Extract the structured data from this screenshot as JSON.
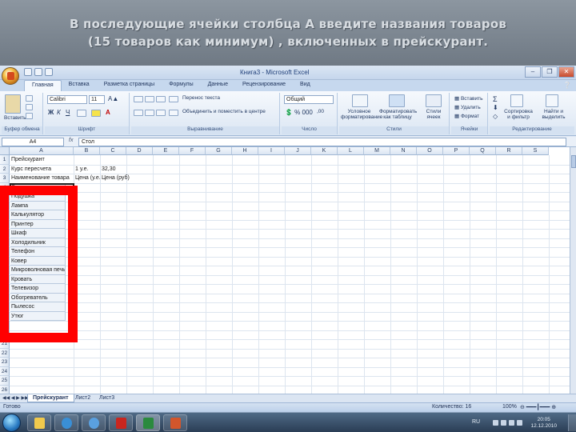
{
  "slide": {
    "title_line1": "В последующие ячейки столбца А введите названия товаров",
    "title_line2": "(15 товаров как минимум) , включенных в прейскурант."
  },
  "window": {
    "title": "Книга3 - Microsoft Excel",
    "controls": [
      "–",
      "❐",
      "✕"
    ]
  },
  "tabs": [
    "Главная",
    "Вставка",
    "Разметка страницы",
    "Формулы",
    "Данные",
    "Рецензирование",
    "Вид"
  ],
  "ribbon": {
    "groups": [
      "Буфер обмена",
      "Шрифт",
      "Выравнивание",
      "Число",
      "Стили",
      "Ячейки",
      "Редактирование"
    ],
    "paste_label": "Вставить",
    "font_name": "Calibri",
    "font_size": "11",
    "wrap_text": "Перенос текста",
    "merge_center": "Объединить и поместить в центре",
    "number_format": "Общий",
    "cond_format": "Условное форматирование",
    "format_table": "Форматировать как таблицу",
    "cell_styles": "Стили ячеек",
    "insert": "Вставить",
    "delete": "Удалить",
    "format": "Формат",
    "sort_filter": "Сортировка и фильтр",
    "find_select": "Найти и выделить"
  },
  "formula_bar": {
    "name_box": "A4",
    "fx": "fx",
    "content": "Стол"
  },
  "grid": {
    "columns": [
      "A",
      "B",
      "C",
      "D",
      "E",
      "F",
      "G",
      "H",
      "I",
      "J",
      "K",
      "L",
      "M",
      "N",
      "O",
      "P",
      "Q",
      "R",
      "S"
    ],
    "rows": [
      "1",
      "2",
      "3",
      "4",
      "5",
      "6",
      "7",
      "8",
      "9",
      "10",
      "11",
      "12",
      "13",
      "14",
      "15",
      "16",
      "17",
      "18",
      "19",
      "20",
      "21",
      "22",
      "23",
      "24",
      "25",
      "26"
    ],
    "r1_a": "Прейскурант",
    "r2_a": "Курс пересчета",
    "r2_b": "1 у.е.",
    "r2_c": "32,30",
    "r3_a": "Наименование товара",
    "r3_b": "Цена (у.е.)",
    "r3_c": "Цена (руб)",
    "items": [
      "Стол",
      "Подушка",
      "Лампа",
      "Калькулятор",
      "Принтер",
      "Шкаф",
      "Холодильник",
      "Телефон",
      "Ковер",
      "Микроволновая печь",
      "Кровать",
      "Телевизор",
      "Обогреватель",
      "Пылесос",
      "Утюг"
    ]
  },
  "sheets": [
    "Прейскурант",
    "Лист2",
    "Лист3"
  ],
  "status": {
    "ready": "Готово",
    "count": "Количество: 16",
    "zoom": "100%"
  },
  "taskbar": {
    "lang": "RU",
    "time": "20:05",
    "date": "12.12.2010"
  }
}
